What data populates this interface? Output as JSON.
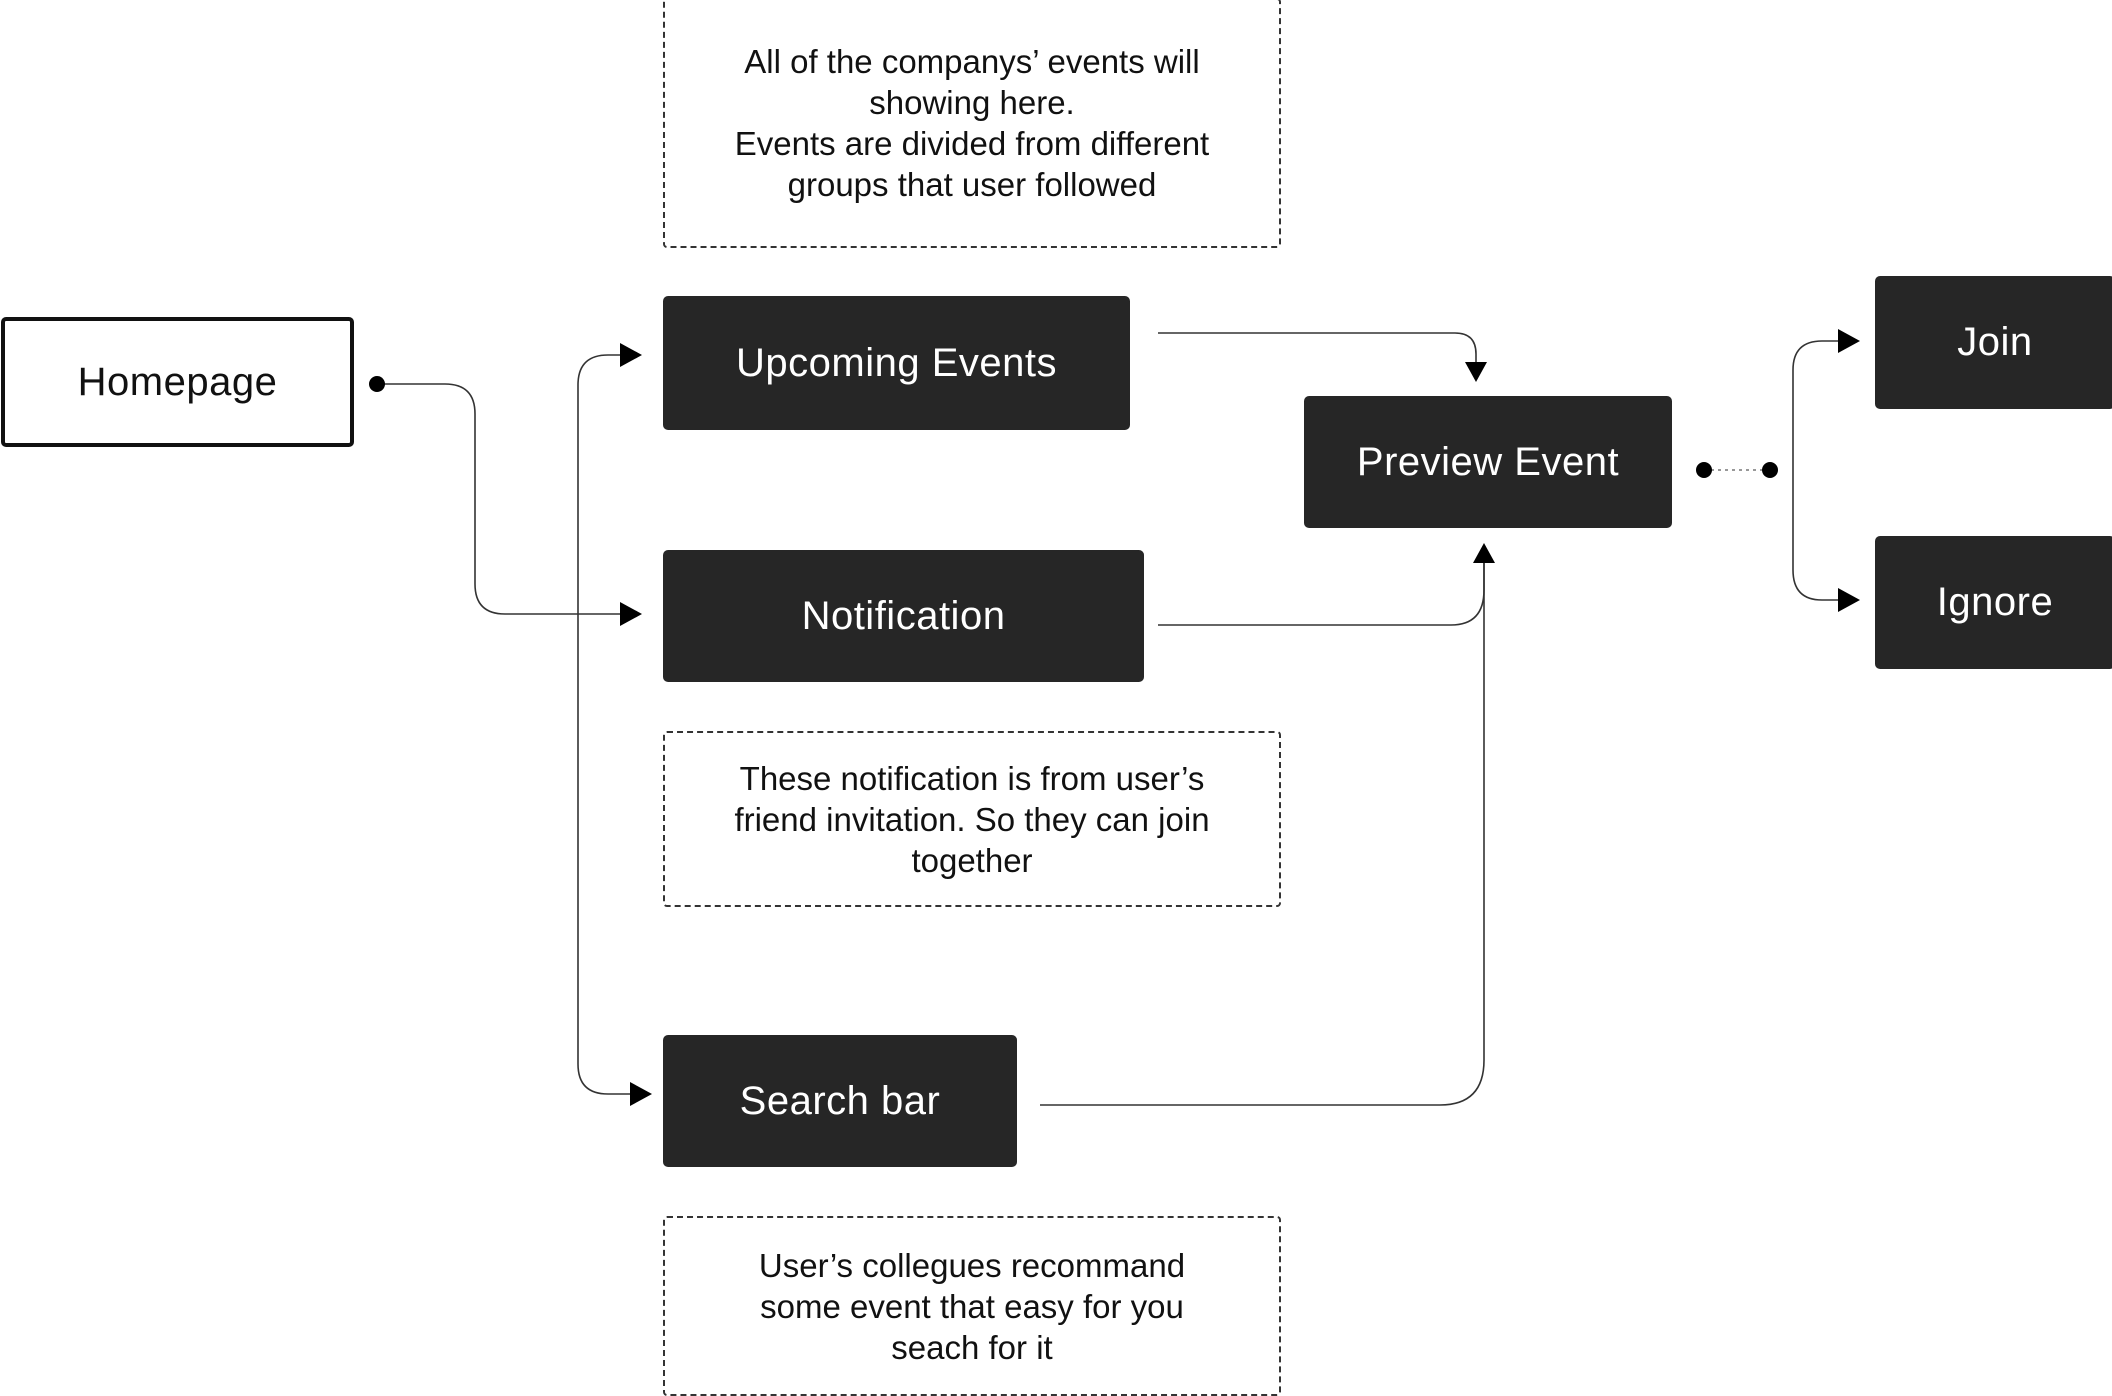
{
  "diagram": {
    "nodes": {
      "homepage": "Homepage",
      "upcoming_events": "Upcoming Events",
      "notification": "Notification",
      "search_bar": "Search bar",
      "preview_event": "Preview Event",
      "join": "Join",
      "ignore": "Ignore"
    },
    "notes": {
      "upcoming_events": "All of the companys’ events will\nshowing here.\nEvents are divided from different\ngroups that user followed",
      "notification": "These notification is from user’s\nfriend invitation. So they can join\ntogether",
      "search_bar": "User’s collegues recommand\nsome event that easy for you\nseach for it"
    },
    "edges": [
      {
        "from": "homepage",
        "to": "upcoming_events"
      },
      {
        "from": "homepage",
        "to": "notification"
      },
      {
        "from": "homepage",
        "to": "search_bar"
      },
      {
        "from": "upcoming_events",
        "to": "preview_event"
      },
      {
        "from": "notification",
        "to": "preview_event"
      },
      {
        "from": "search_bar",
        "to": "preview_event"
      },
      {
        "from": "preview_event",
        "to": "join"
      },
      {
        "from": "preview_event",
        "to": "ignore"
      }
    ],
    "colors": {
      "node_fill": "#262626",
      "node_text": "#ffffff",
      "line": "#111111"
    }
  }
}
